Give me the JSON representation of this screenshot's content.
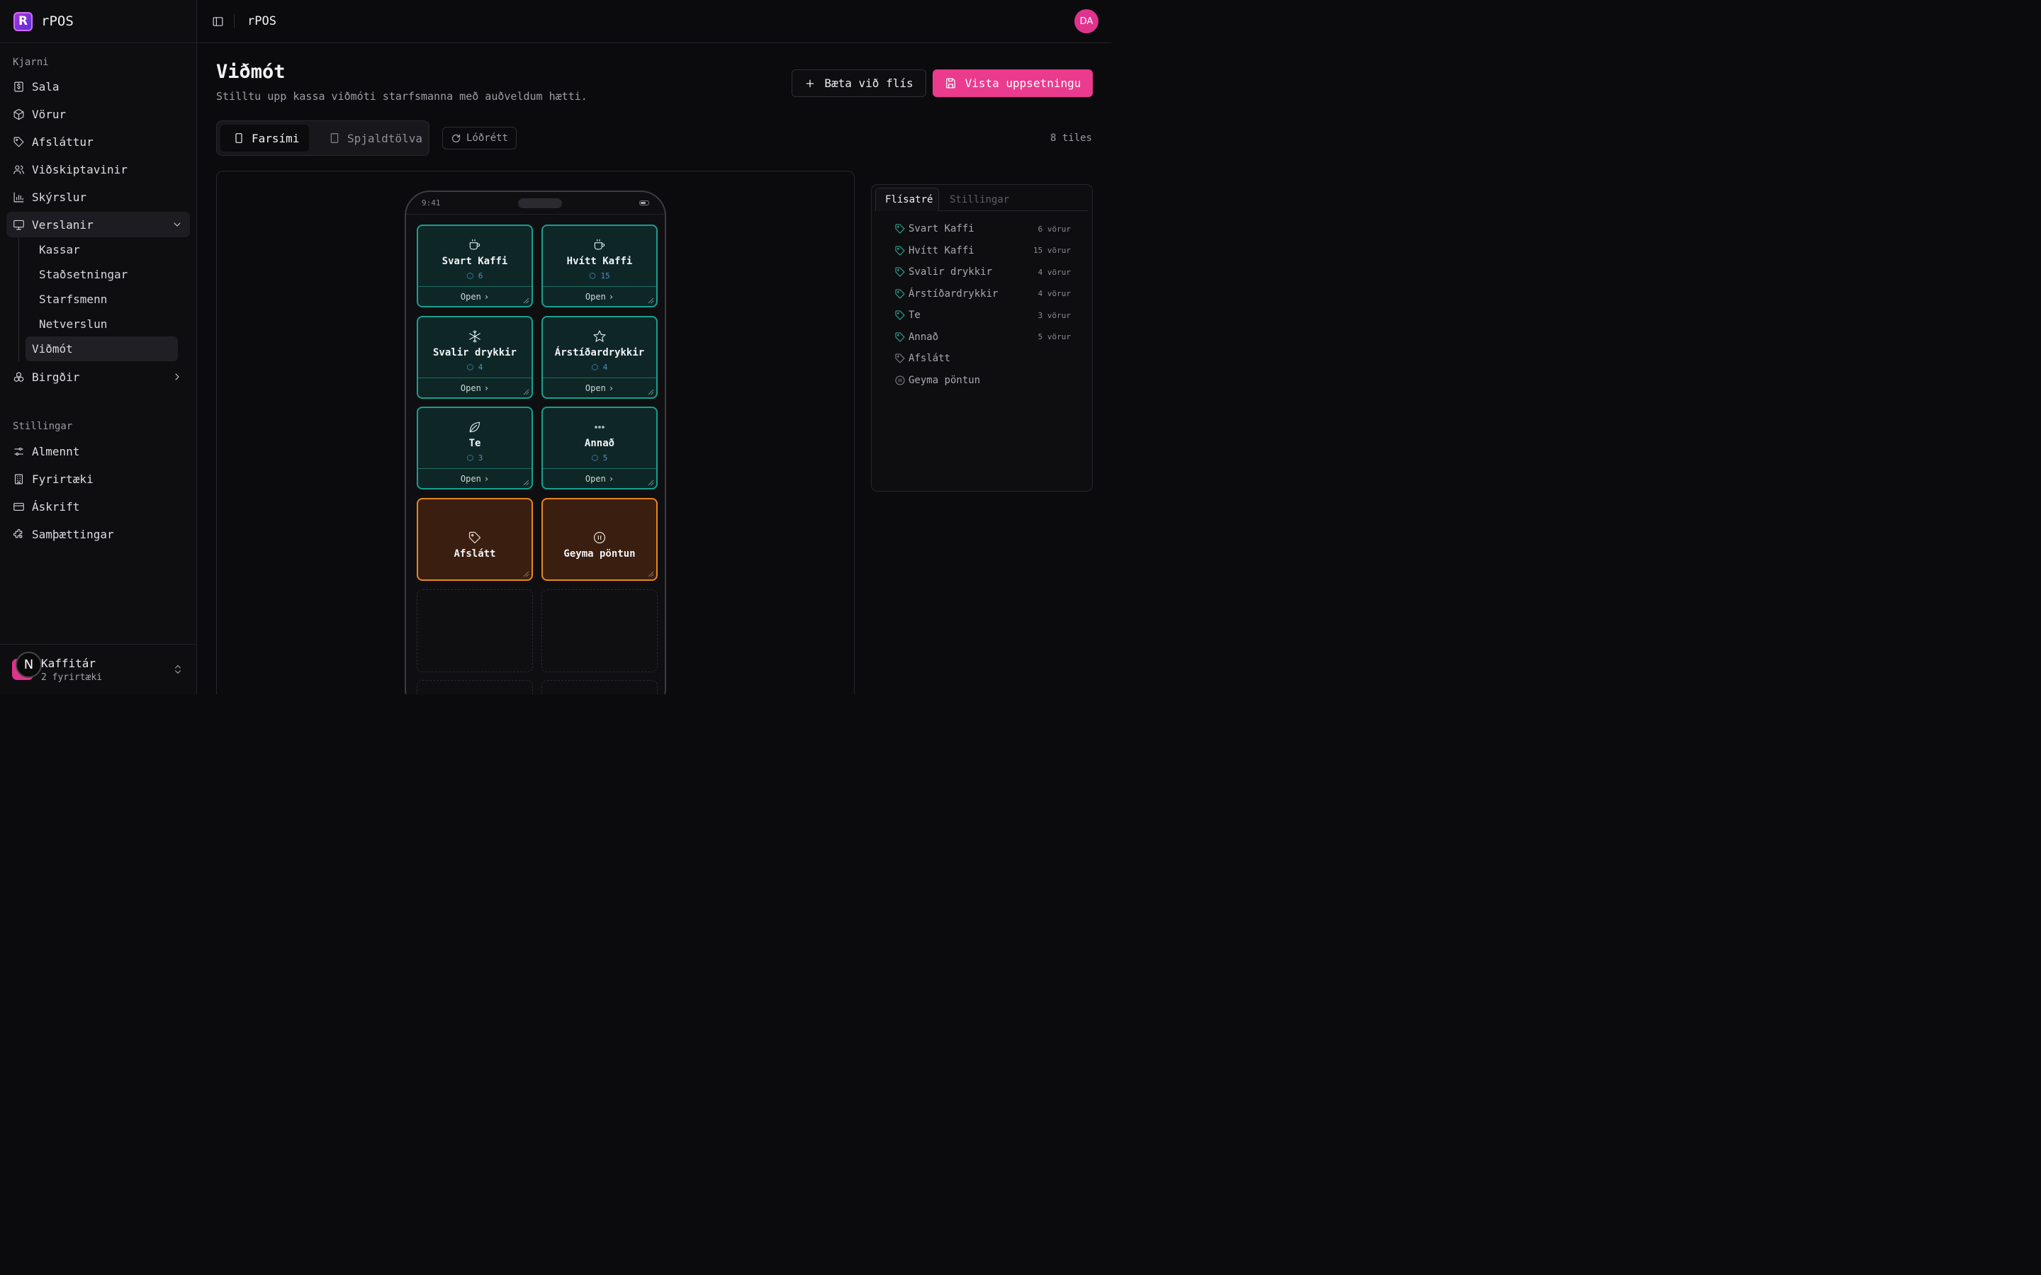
{
  "brand": {
    "name": "rPOS"
  },
  "header": {
    "title": "rPOS",
    "user_initials": "DA"
  },
  "sidebar": {
    "section_core": "Kjarni",
    "core_items": [
      {
        "label": "Sala",
        "icon": "receipt-dollar-icon"
      },
      {
        "label": "Vörur",
        "icon": "package-icon"
      },
      {
        "label": "Afsláttur",
        "icon": "tag-icon"
      },
      {
        "label": "Viðskiptavinir",
        "icon": "users-icon"
      },
      {
        "label": "Skýrslur",
        "icon": "bar-chart-icon"
      },
      {
        "label": "Verslanir",
        "icon": "monitor-icon"
      }
    ],
    "store_sub": [
      "Kassar",
      "Staðsetningar",
      "Starfsmenn",
      "Netverslun",
      "Viðmót"
    ],
    "inventory": {
      "label": "Birgðir",
      "icon": "boxes-icon"
    },
    "section_settings": "Stillingar",
    "settings_items": [
      {
        "label": "Almennt",
        "icon": "sliders-icon"
      },
      {
        "label": "Fyrirtæki",
        "icon": "building-icon"
      },
      {
        "label": "Áskrift",
        "icon": "credit-card-icon"
      },
      {
        "label": "Samþættingar",
        "icon": "puzzle-icon"
      }
    ],
    "org": {
      "name": "Kaffitár",
      "sub": "2 fyrirtæki",
      "badge": "N"
    }
  },
  "page": {
    "title": "Viðmót",
    "subtitle": "Stilltu upp kassa viðmóti starfsmanna með auðveldum hætti.",
    "add_tile": "Bæta við flís",
    "save": "Vista uppsetningu",
    "device_mobile": "Farsími",
    "device_tablet": "Spjaldtölva",
    "orientation": "Lóðrétt",
    "tile_count": "8 tiles"
  },
  "phone": {
    "time": "9:41",
    "tiles": [
      {
        "name": "Svart Kaffi",
        "count": "6",
        "open": "Open",
        "icon": "coffee-cup-icon"
      },
      {
        "name": "Hvítt Kaffi",
        "count": "15",
        "open": "Open",
        "icon": "coffee-cup-icon"
      },
      {
        "name": "Svalir drykkir",
        "count": "4",
        "open": "Open",
        "icon": "snowflake-icon"
      },
      {
        "name": "Árstíðardrykkir",
        "count": "4",
        "open": "Open",
        "icon": "star-icon"
      },
      {
        "name": "Te",
        "count": "3",
        "open": "Open",
        "icon": "leaf-icon"
      },
      {
        "name": "Annað",
        "count": "5",
        "open": "Open",
        "icon": "more-dots-icon"
      },
      {
        "name": "Afslátt",
        "icon": "tag-icon"
      },
      {
        "name": "Geyma pöntun",
        "icon": "pause-icon"
      }
    ]
  },
  "panel": {
    "tab_tree": "Flísatré",
    "tab_settings": "Stillingar",
    "rows": [
      {
        "label": "Svart Kaffi",
        "count": "6 vörur"
      },
      {
        "label": "Hvítt Kaffi",
        "count": "15 vörur"
      },
      {
        "label": "Svalir drykkir",
        "count": "4 vörur"
      },
      {
        "label": "Árstíðardrykkir",
        "count": "4 vörur"
      },
      {
        "label": "Te",
        "count": "3 vörur"
      },
      {
        "label": "Annað",
        "count": "5 vörur"
      },
      {
        "label": "Afslátt",
        "count": ""
      },
      {
        "label": "Geyma pöntun",
        "count": ""
      }
    ]
  },
  "colors": {
    "accent": "#ea3b8f",
    "tile_teal": "#16a090",
    "tile_orange": "#e7871d",
    "tree_tag": "#2bb5a3"
  }
}
